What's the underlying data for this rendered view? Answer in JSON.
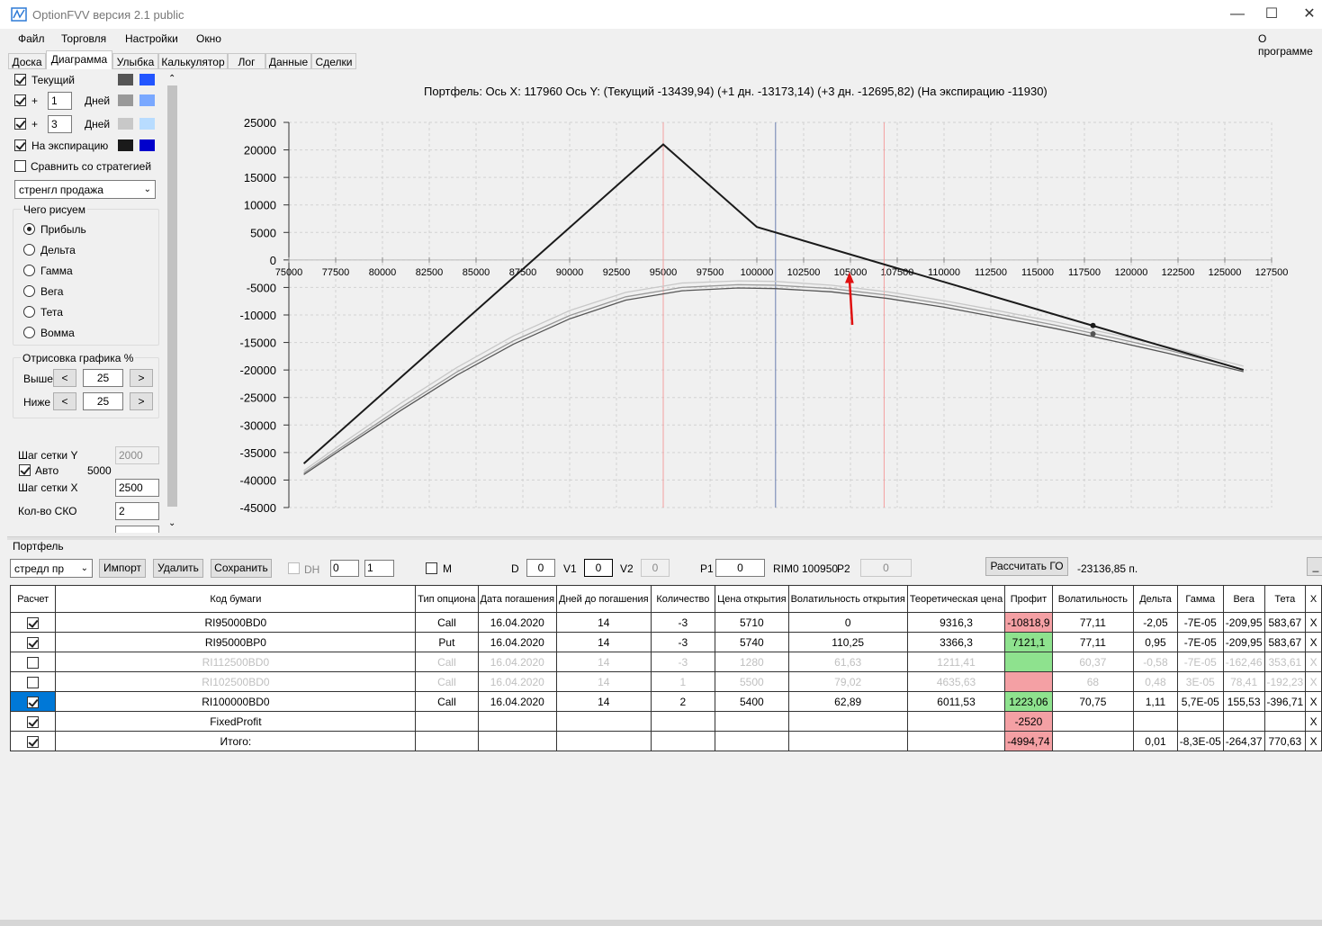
{
  "window": {
    "title": "OptionFVV версия 2.1 public"
  },
  "menu": {
    "items": [
      "Файл",
      "Торговля",
      "Настройки",
      "Окно"
    ],
    "about": "О программе"
  },
  "tabs": [
    "Доска",
    "Диаграмма",
    "Улыбка",
    "Калькулятор",
    "Лог",
    "Данные",
    "Сделки"
  ],
  "left": {
    "current_label": "Текущий",
    "plus1": {
      "sign": "+",
      "value": "1",
      "unit": "Дней"
    },
    "plus3": {
      "sign": "+",
      "value": "3",
      "unit": "Дней"
    },
    "expiry_label": "На экспирацию",
    "compare_label": "Сравнить со стратегией",
    "strategy": "стренгл продажа",
    "what_group": "Чего рисуем",
    "radios": [
      "Прибыль",
      "Дельта",
      "Гамма",
      "Вега",
      "Тета",
      "Вомма"
    ],
    "draw_group": "Отрисовка графика %",
    "above_label": "Выше",
    "above_value": "25",
    "below_label": "Ниже",
    "below_value": "25",
    "step_y_label": "Шаг сетки Y",
    "step_y_value": "2000",
    "auto_label": "Авто",
    "auto_value": "5000",
    "step_x_label": "Шаг сетки X",
    "step_x_value": "2500",
    "sko_label": "Кол-во СКО",
    "sko_value": "2",
    "lt": "<",
    "gt": ">",
    "swatches": {
      "current": [
        "#555555",
        "#2255ff"
      ],
      "plus1": [
        "#999999",
        "#7aa8ff"
      ],
      "plus3": [
        "#c8c8c8",
        "#b8dcff"
      ],
      "expiry": [
        "#1a1a1a",
        "#0000cc"
      ]
    }
  },
  "chart": {
    "title": "Портфель: Ось X:  117960 Ось Y:  (Текущий -13439,94)  (+1 дн. -13173,14)  (+3 дн. -12695,82)  (На экспирацию -11930)"
  },
  "chart_data": {
    "type": "line",
    "xlim": [
      75000,
      127500
    ],
    "ylim": [
      -45000,
      25000
    ],
    "x_ticks": [
      75000,
      77500,
      80000,
      82500,
      85000,
      87500,
      90000,
      92500,
      95000,
      97500,
      100000,
      102500,
      105000,
      107500,
      110000,
      112500,
      115000,
      117500,
      120000,
      122500,
      125000,
      127500
    ],
    "y_ticks": [
      25000,
      20000,
      15000,
      10000,
      5000,
      0,
      -5000,
      -10000,
      -15000,
      -20000,
      -25000,
      -30000,
      -35000,
      -40000,
      -45000
    ],
    "vertical_lines": [
      {
        "x": 95000,
        "color": "#f4a0a0"
      },
      {
        "x": 101000,
        "color": "#6a7fb0"
      },
      {
        "x": 106800,
        "color": "#f4a0a0"
      }
    ],
    "cursor_x": 117960,
    "series": [
      {
        "color": "#1a1a1a",
        "x": [
          75800,
          95000,
          100000,
          126000
        ],
        "y": [
          -37000,
          21000,
          6000,
          -20000
        ],
        "marker": {
          "x": 117960,
          "y": -11930
        }
      },
      {
        "color": "#c8c8c8",
        "x": [
          75800,
          78000,
          81000,
          84000,
          87000,
          90000,
          93000,
          96000,
          99000,
          101000,
          104000,
          107000,
          110000,
          113000,
          116000,
          119000,
          122000,
          126000
        ],
        "y": [
          -38300,
          -33000,
          -26000,
          -19500,
          -13800,
          -9200,
          -5900,
          -4200,
          -3800,
          -3900,
          -4600,
          -5800,
          -7400,
          -9300,
          -11300,
          -13500,
          -15800,
          -19300
        ]
      },
      {
        "color": "#999999",
        "x": [
          75800,
          78000,
          81000,
          84000,
          87000,
          90000,
          93000,
          96000,
          99000,
          101000,
          104000,
          107000,
          110000,
          113000,
          116000,
          119000,
          122000,
          126000
        ],
        "y": [
          -38700,
          -33600,
          -26800,
          -20300,
          -14700,
          -10100,
          -6700,
          -5000,
          -4500,
          -4600,
          -5200,
          -6400,
          -8000,
          -9900,
          -11900,
          -14100,
          -16400,
          -19900
        ]
      },
      {
        "color": "#555555",
        "x": [
          75800,
          78000,
          81000,
          84000,
          87000,
          90000,
          93000,
          96000,
          99000,
          101000,
          104000,
          107000,
          110000,
          113000,
          116000,
          119000,
          122000,
          126000
        ],
        "y": [
          -39000,
          -34000,
          -27300,
          -20900,
          -15300,
          -10700,
          -7300,
          -5600,
          -5100,
          -5200,
          -5800,
          -7000,
          -8600,
          -10500,
          -12500,
          -14700,
          -17000,
          -20300
        ],
        "marker": {
          "x": 117960,
          "y": -13440
        }
      }
    ]
  },
  "portfolio": {
    "label": "Портфель",
    "select": "стредл пр",
    "import": "Импорт",
    "delete": "Удалить",
    "save": "Сохранить",
    "dh": "DH",
    "dh_v1": "0",
    "dh_v2": "1",
    "m": "M",
    "d_label": "D",
    "d_value": "0",
    "v1_label": "V1",
    "v1_value": "0",
    "v2_label": "V2",
    "v2_value": "0",
    "p1_label": "P1",
    "p1_value": "0",
    "rim": "RIM0 100950",
    "p2_label": "P2",
    "p2_value": "0",
    "calc_go": "Рассчитать ГО",
    "go_value": "-23136,85 п.",
    "min": "_"
  },
  "table": {
    "headers": [
      "Расчет",
      "Код бумаги",
      "Тип опциона",
      "Дата погашения",
      "Дней до погашения",
      "Количество",
      "Цена открытия",
      "Волатильность открытия",
      "Теоретическая цена",
      "Профит",
      "Волатильность",
      "Дельта",
      "Гамма",
      "Вега",
      "Тета",
      "X"
    ],
    "rows": [
      {
        "check": true,
        "sel": false,
        "inactive": false,
        "profit_color": "#f4a0a4",
        "cells": [
          "RI95000BD0",
          "Call",
          "16.04.2020",
          "14",
          "-3",
          "5710",
          "0",
          "9316,3",
          "-10818,9",
          "77,11",
          "-2,05",
          "-7E-05",
          "-209,95",
          "583,67",
          "X"
        ]
      },
      {
        "check": true,
        "sel": false,
        "inactive": false,
        "profit_color": "#8ee28e",
        "cells": [
          "RI95000BP0",
          "Put",
          "16.04.2020",
          "14",
          "-3",
          "5740",
          "110,25",
          "3366,3",
          "7121,1",
          "77,11",
          "0,95",
          "-7E-05",
          "-209,95",
          "583,67",
          "X"
        ]
      },
      {
        "check": false,
        "sel": false,
        "inactive": true,
        "profit_color": "#8ee28e",
        "cells": [
          "RI112500BD0",
          "Call",
          "16.04.2020",
          "14",
          "-3",
          "1280",
          "61,63",
          "1211,41",
          "",
          "60,37",
          "-0,58",
          "-7E-05",
          "-162,46",
          "353,61",
          "X"
        ]
      },
      {
        "check": false,
        "sel": false,
        "inactive": true,
        "profit_color": "#f4a0a4",
        "cells": [
          "RI102500BD0",
          "Call",
          "16.04.2020",
          "14",
          "1",
          "5500",
          "79,02",
          "4635,63",
          "",
          "68",
          "0,48",
          "3E-05",
          "78,41",
          "-192,23",
          "X"
        ]
      },
      {
        "check": true,
        "sel": true,
        "inactive": false,
        "profit_color": "#8ee28e",
        "cells": [
          "RI100000BD0",
          "Call",
          "16.04.2020",
          "14",
          "2",
          "5400",
          "62,89",
          "6011,53",
          "1223,06",
          "70,75",
          "1,11",
          "5,7E-05",
          "155,53",
          "-396,71",
          "X"
        ]
      },
      {
        "check": true,
        "sel": false,
        "inactive": false,
        "profit_color": "#f4a0a4",
        "cells": [
          "FixedProfit",
          "",
          "",
          "",
          "",
          "",
          "",
          "",
          "-2520",
          "",
          "",
          "",
          "",
          "",
          "X"
        ]
      },
      {
        "check": true,
        "sel": false,
        "inactive": false,
        "profit_color": "#f4a0a4",
        "cells": [
          "Итого:",
          "",
          "",
          "",
          "",
          "",
          "",
          "",
          "-4994,74",
          "",
          "0,01",
          "-8,3E-05",
          "-264,37",
          "770,63",
          "X"
        ]
      }
    ]
  }
}
